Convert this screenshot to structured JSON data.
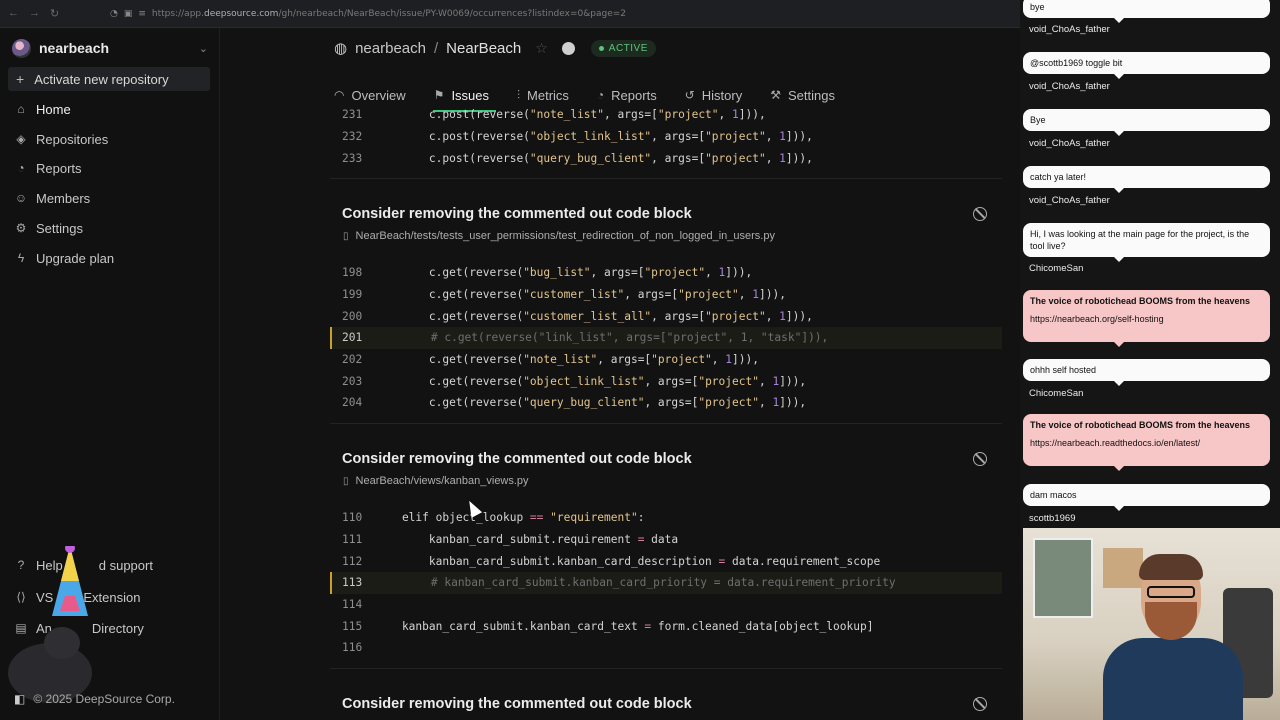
{
  "browser": {
    "url_prefix": "https://app.",
    "url_domain": "deepsource.com",
    "url_rest": "/gh/nearbeach/NearBeach/issue/PY-W0069/occurrences?listindex=0&page=2"
  },
  "sidebar": {
    "org_name": "nearbeach",
    "activate_label": "Activate new repository",
    "items": [
      {
        "label": "Home",
        "icon": "home-icon"
      },
      {
        "label": "Repositories",
        "icon": "layers-icon"
      },
      {
        "label": "Reports",
        "icon": "chart-icon"
      },
      {
        "label": "Members",
        "icon": "users-icon"
      },
      {
        "label": "Settings",
        "icon": "gear-icon"
      },
      {
        "label": "Upgrade plan",
        "icon": "bolt-icon"
      }
    ],
    "footer": [
      {
        "label": "Help and support"
      },
      {
        "label": "VS Code Extension"
      },
      {
        "label": "Analyzer Directory"
      }
    ],
    "footer_visible": [
      "Help",
      "d support",
      "VS",
      "Extension",
      "An",
      "Directory"
    ],
    "copyright": "© 2025 DeepSource Corp."
  },
  "repo": {
    "org": "nearbeach",
    "separator": "/",
    "name": "NearBeach",
    "status": "ACTIVE"
  },
  "tabs": [
    {
      "label": "Overview",
      "active": false
    },
    {
      "label": "Issues",
      "active": true
    },
    {
      "label": "Metrics",
      "active": false
    },
    {
      "label": "Reports",
      "active": false
    },
    {
      "label": "History",
      "active": false
    },
    {
      "label": "Settings",
      "active": false
    }
  ],
  "block0": {
    "lines": [
      {
        "n": "231",
        "code": "        c.post(reverse(\"note_list\", args=[\"project\", 1])),"
      },
      {
        "n": "232",
        "code": "        c.post(reverse(\"object_link_list\", args=[\"project\", 1])),"
      },
      {
        "n": "233",
        "code": "        c.post(reverse(\"query_bug_client\", args=[\"project\", 1])),"
      }
    ]
  },
  "block1": {
    "title": "Consider removing the commented out code block",
    "path": "NearBeach/tests/tests_user_permissions/test_redirection_of_non_logged_in_users.py",
    "lines": [
      {
        "n": "198",
        "code": "        c.get(reverse(\"bug_list\", args=[\"project\", 1])),"
      },
      {
        "n": "199",
        "code": "        c.get(reverse(\"customer_list\", args=[\"project\", 1])),"
      },
      {
        "n": "200",
        "code": "        c.get(reverse(\"customer_list_all\", args=[\"project\", 1])),"
      },
      {
        "n": "201",
        "code": "        # c.get(reverse(\"link_list\", args=[\"project\", 1, \"task\"])),"
      },
      {
        "n": "202",
        "code": "        c.get(reverse(\"note_list\", args=[\"project\", 1])),"
      },
      {
        "n": "203",
        "code": "        c.get(reverse(\"object_link_list\", args=[\"project\", 1])),"
      },
      {
        "n": "204",
        "code": "        c.get(reverse(\"query_bug_client\", args=[\"project\", 1])),"
      }
    ]
  },
  "block2": {
    "title": "Consider removing the commented out code block",
    "path": "NearBeach/views/kanban_views.py",
    "lines": [
      {
        "n": "110",
        "code": "    elif object_lookup == \"requirement\":"
      },
      {
        "n": "111",
        "code": "        kanban_card_submit.requirement = data"
      },
      {
        "n": "112",
        "code": "        kanban_card_submit.kanban_card_description = data.requirement_scope"
      },
      {
        "n": "113",
        "code": "        # kanban_card_submit.kanban_card_priority = data.requirement_priority"
      },
      {
        "n": "114",
        "code": ""
      },
      {
        "n": "115",
        "code": "    kanban_card_submit.kanban_card_text = form.cleaned_data[object_lookup]"
      },
      {
        "n": "116",
        "code": ""
      }
    ]
  },
  "block3": {
    "title": "Consider removing the commented out code block"
  },
  "chat": [
    {
      "text": "bye",
      "user": "void_ChoAs_father"
    },
    {
      "text": "@scottb1969 toggle bit",
      "user": "void_ChoAs_father"
    },
    {
      "text": "Bye",
      "user": "void_ChoAs_father"
    },
    {
      "text": "catch ya later!",
      "user": "void_ChoAs_father"
    },
    {
      "text": "Hi, I was looking at the main page for the project, is the tool live?",
      "user": "ChicomeSan"
    },
    {
      "title": "The voice of robotichead BOOMS from the heavens",
      "text": "https://nearbeach.org/self-hosting"
    },
    {
      "text": "ohhh self hosted",
      "user": "ChicomeSan"
    },
    {
      "title": "The voice of robotichead BOOMS from the heavens",
      "text": "https://nearbeach.readthedocs.io/en/latest/"
    },
    {
      "text": "dam macos",
      "user": "scottb1969"
    }
  ],
  "colors": {
    "accent": "#3ec47c",
    "highlight_border": "#c9a227",
    "chat_pink": "#f7c6c6"
  }
}
